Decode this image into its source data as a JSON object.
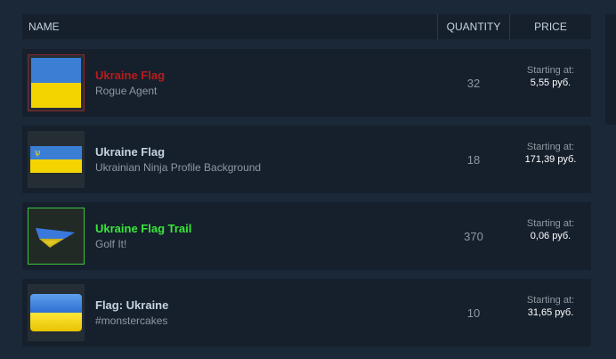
{
  "header": {
    "name_label": "NAME",
    "quantity_label": "QUANTITY",
    "price_label": "PRICE"
  },
  "colors": {
    "background": "#1b2838",
    "row_bg": "#16202d",
    "red_name": "#b71c1c",
    "gray_name": "#c6d4df",
    "green_name": "#39e639"
  },
  "listings": [
    {
      "name": "Ukraine Flag",
      "game": "Rogue Agent",
      "quantity": "32",
      "price_label": "Starting at:",
      "price": "5,55 руб.",
      "name_color": "#b71c1c",
      "icon": "ukraine-flag-icon"
    },
    {
      "name": "Ukraine Flag",
      "game": "Ukrainian Ninja Profile Background",
      "quantity": "18",
      "price_label": "Starting at:",
      "price": "171,39 руб.",
      "name_color": "#c6d4df",
      "icon": "ukraine-flag-background-icon"
    },
    {
      "name": "Ukraine Flag Trail",
      "game": "Golf It!",
      "quantity": "370",
      "price_label": "Starting at:",
      "price": "0,06 руб.",
      "name_color": "#39e639",
      "icon": "flag-trail-icon"
    },
    {
      "name": "Flag: Ukraine",
      "game": "#monstercakes",
      "quantity": "10",
      "price_label": "Starting at:",
      "price": "31,65 руб.",
      "name_color": "#c6d4df",
      "icon": "ukraine-flag-sticker-icon"
    }
  ]
}
